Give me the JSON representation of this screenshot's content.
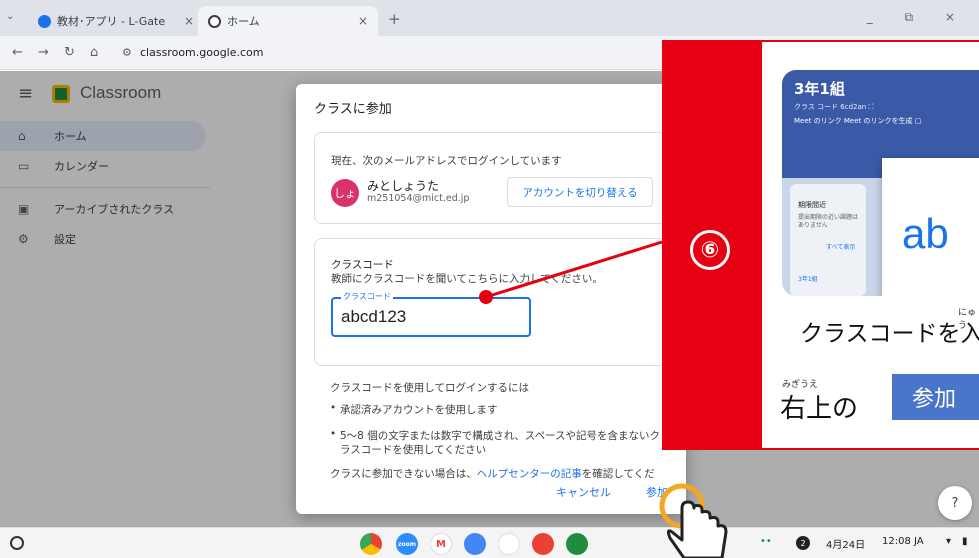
{
  "browser": {
    "tabs": [
      {
        "title": "教材･アプリ - L-Gate",
        "favicon_color": "#1a73e8"
      },
      {
        "title": "ホーム",
        "favicon_color": "#3c4043"
      }
    ],
    "new_tab": "+",
    "window_controls": "_ ⧉ ×",
    "url": "classroom.google.com"
  },
  "app": {
    "title": "Classroom",
    "sidebar": [
      {
        "icon": "home-icon",
        "label": "ホーム"
      },
      {
        "icon": "calendar-icon",
        "label": "カレンダー"
      },
      {
        "icon": "archive-icon",
        "label": "アーカイブされたクラス"
      },
      {
        "icon": "settings-icon",
        "label": "設定"
      }
    ]
  },
  "dialog": {
    "title": "クラスに参加",
    "login_text": "現在、次のメールアドレスでログインしています",
    "avatar_initials": "しょ",
    "user_name": "みとしょうた",
    "user_email": "m251054@mict.ed.jp",
    "switch_account": "アカウントを切り替える",
    "code_heading": "クラスコード",
    "code_desc": "教師にクラスコードを聞いてこちらに入力してください。",
    "code_label": "クラスコード",
    "code_value": "abcd123",
    "info_heading": "クラスコードを使用してログインするには",
    "info_bullet1": "承認済みアカウントを使用します",
    "info_bullet2a": "5～8 個の文字または数字で構成され、スペースや記号を含まないク",
    "info_bullet2b": "ラスコードを使用してください",
    "help_prefix": "クラスに参加できない場合は、",
    "help_link": "ヘルプセンターの記事",
    "help_suffix": "を確認してくだ",
    "cancel": "キャンセル",
    "join": "参加"
  },
  "tutorial": {
    "step": "⑥",
    "class_name": "3年1組",
    "class_code_line": "クラス コード 6cd2an ⛶",
    "meet_line": "Meet のリンク  Meet のリンクを生成 ▢",
    "side_title": "期限間近",
    "side_desc": "提出期限の近い課題はありません",
    "side_link": "すべて表示",
    "side_small": "3年1組",
    "big_text": "ab",
    "line1": "クラスコードを入",
    "ruby1": "にゅう",
    "line2": "右上の",
    "ruby2": "みぎうえ",
    "join_btn": "参加"
  },
  "help_button": "?",
  "taskbar": {
    "date": "4月24日",
    "time": "12:08 JA",
    "notif_count": "2",
    "zoom_label": "zoom",
    "gmail_label": "M"
  },
  "colors": {
    "accent_red": "#e60012",
    "link_blue": "#1a73e8",
    "cursor_orange": "#f5a623"
  }
}
